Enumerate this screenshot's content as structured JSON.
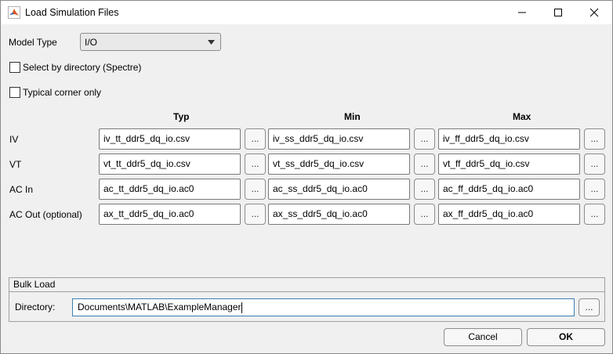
{
  "window": {
    "title": "Load Simulation Files"
  },
  "model_type": {
    "label": "Model Type",
    "selected": "I/O"
  },
  "options": {
    "select_by_directory": "Select by directory (Spectre)",
    "typical_corner_only": "Typical corner only"
  },
  "columns": [
    "Typ",
    "Min",
    "Max"
  ],
  "browse_label": "...",
  "rows": [
    {
      "label": "IV",
      "typ": "iv_tt_ddr5_dq_io.csv",
      "min": "iv_ss_ddr5_dq_io.csv",
      "max": "iv_ff_ddr5_dq_io.csv"
    },
    {
      "label": "VT",
      "typ": "vt_tt_ddr5_dq_io.csv",
      "min": "vt_ss_ddr5_dq_io.csv",
      "max": "vt_ff_ddr5_dq_io.csv"
    },
    {
      "label": "AC In",
      "typ": "ac_tt_ddr5_dq_io.ac0",
      "min": "ac_ss_ddr5_dq_io.ac0",
      "max": "ac_ff_ddr5_dq_io.ac0"
    },
    {
      "label": "AC Out (optional)",
      "typ": "ax_tt_ddr5_dq_io.ac0",
      "min": "ax_ss_ddr5_dq_io.ac0",
      "max": "ax_ff_ddr5_dq_io.ac0"
    }
  ],
  "bulk_load": {
    "title": "Bulk Load",
    "directory_label": "Directory:",
    "directory_value": "Documents\\MATLAB\\ExampleManager"
  },
  "buttons": {
    "cancel": "Cancel",
    "ok": "OK"
  }
}
